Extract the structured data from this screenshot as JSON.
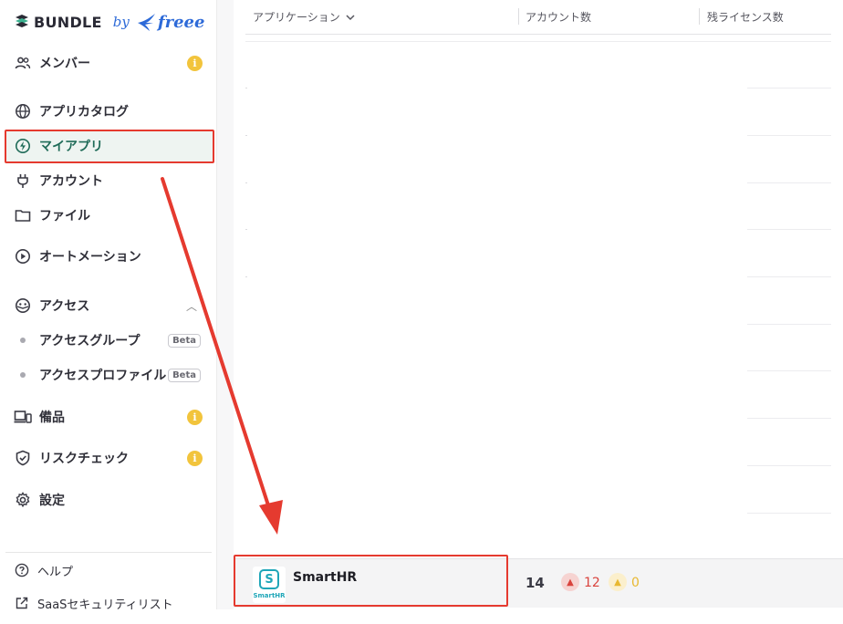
{
  "logo": {
    "brand": "BUNDLE",
    "by": "by",
    "partner": "freee"
  },
  "sidebar": {
    "items": [
      {
        "label": "メンバー",
        "info": "i"
      },
      {
        "label": "アプリカタログ"
      },
      {
        "label": "マイアプリ"
      },
      {
        "label": "アカウント"
      },
      {
        "label": "ファイル"
      },
      {
        "label": "オートメーション"
      },
      {
        "label": "アクセス"
      },
      {
        "label": "備品",
        "info": "i"
      },
      {
        "label": "リスクチェック",
        "info": "i"
      },
      {
        "label": "設定"
      }
    ],
    "sub_items": [
      {
        "label": "アクセスグループ",
        "badge": "Beta"
      },
      {
        "label": "アクセスプロファイル",
        "badge": "Beta"
      }
    ],
    "footer": [
      {
        "label": "ヘルプ"
      },
      {
        "label": "SaaSセキュリティリスト"
      }
    ]
  },
  "table": {
    "headers": {
      "application": "アプリケーション",
      "accounts": "アカウント数",
      "remaining_licenses": "残ライセンス数"
    },
    "row": {
      "app_name": "SmartHR",
      "logo_caption": "SmartHR",
      "logo_letter": "S",
      "account_count": "14",
      "alert_critical": "12",
      "alert_warning": "0"
    }
  },
  "colors": {
    "active_bg": "#eef4f1",
    "active_text": "#1f6b58",
    "info_badge": "#f2c43c",
    "annotation": "#e53a2f",
    "freee_blue": "#2d6ad8",
    "smarthr_teal": "#1fa6b8"
  }
}
